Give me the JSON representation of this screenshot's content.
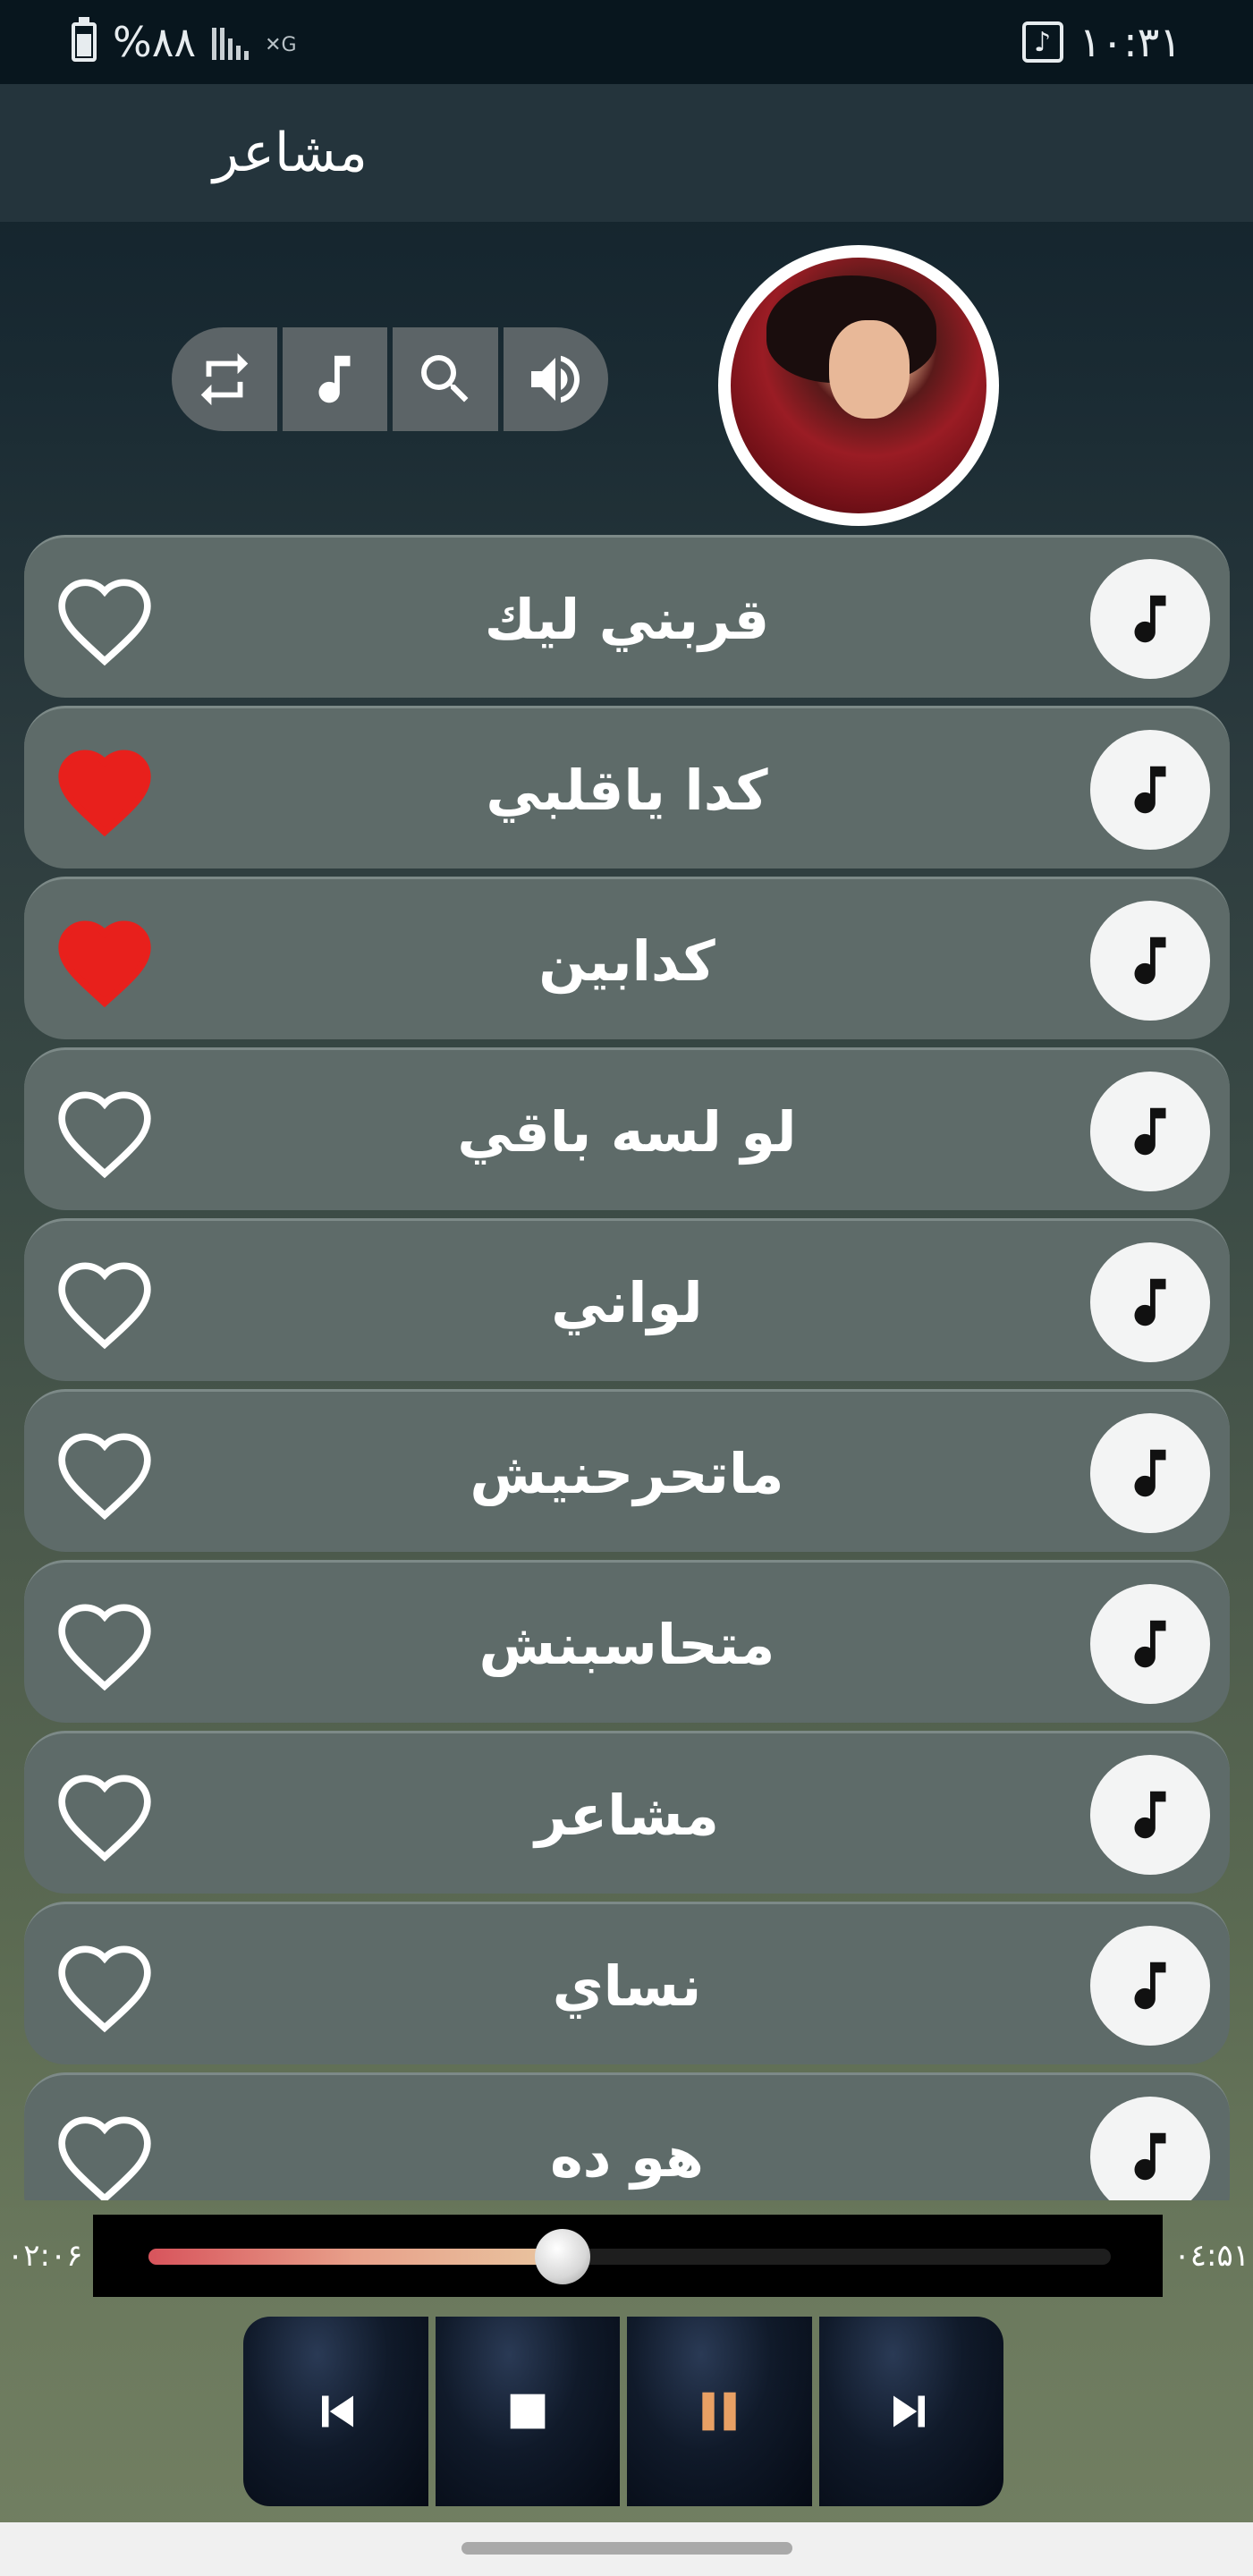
{
  "status_bar": {
    "battery_text": "%۸۸",
    "time": "۱۰:۳۱"
  },
  "app_bar": {
    "title": "مشاعر"
  },
  "controls": [
    {
      "name": "repeat",
      "icon": "repeat-icon"
    },
    {
      "name": "playlist",
      "icon": "music-note-icon"
    },
    {
      "name": "search",
      "icon": "search-icon"
    },
    {
      "name": "volume",
      "icon": "volume-icon"
    }
  ],
  "songs": [
    {
      "title": "قربني ليك",
      "favorite": false
    },
    {
      "title": "كدا ياقلبي",
      "favorite": true
    },
    {
      "title": "كدابين",
      "favorite": true
    },
    {
      "title": "لو لسه باقي",
      "favorite": false
    },
    {
      "title": "لواني",
      "favorite": false
    },
    {
      "title": "ماتحرحنيش",
      "favorite": false
    },
    {
      "title": "متحاسبنش",
      "favorite": false
    },
    {
      "title": "مشاعر",
      "favorite": false
    },
    {
      "title": "نساي",
      "favorite": false
    },
    {
      "title": "هو ده",
      "favorite": false
    }
  ],
  "player": {
    "elapsed": "۰۲:۰۶",
    "duration": "۰٤:۵۱",
    "progress": 0.43,
    "buttons": [
      "previous",
      "stop",
      "pause",
      "next"
    ]
  },
  "colors": {
    "heart_filled": "#e8201c",
    "heart_outline": "#ffffff",
    "pause_accent": "#e8a064"
  }
}
